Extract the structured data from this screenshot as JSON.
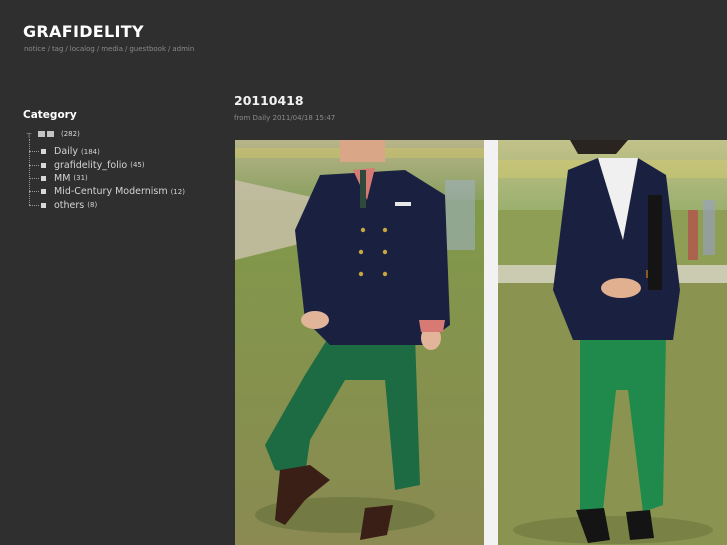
{
  "site": {
    "title": "GRAFIDELITY",
    "nav": [
      "notice",
      "tag",
      "localog",
      "media",
      "guestbook",
      "admin"
    ],
    "nav_separator": "/"
  },
  "sidebar": {
    "heading": "Category",
    "root": {
      "toggle": "⊤",
      "count": "(282)"
    },
    "categories": [
      {
        "label": "Daily",
        "count": "(184)"
      },
      {
        "label": "grafidelity_folio",
        "count": "(45)"
      },
      {
        "label": "MM",
        "count": "(31)"
      },
      {
        "label": "Mid-Century Modernism",
        "count": "(12)"
      },
      {
        "label": "others",
        "count": "(8)"
      }
    ]
  },
  "post": {
    "title": "20110418",
    "meta_prefix": "from",
    "meta_category": "Daily",
    "meta_datetime": "2011/04/18 15:47",
    "images": [
      {
        "icon": "photo-man-navy-blazer-green-trousers"
      },
      {
        "icon": "photo-woman-navy-blazer-green-trousers"
      }
    ]
  },
  "colors": {
    "background": "#2f2f2f",
    "title": "#ffffff",
    "muted": "#8a8a8a",
    "grass": "#6f8f3c",
    "navy": "#1a2140",
    "green_trousers": "#1f7a45"
  }
}
